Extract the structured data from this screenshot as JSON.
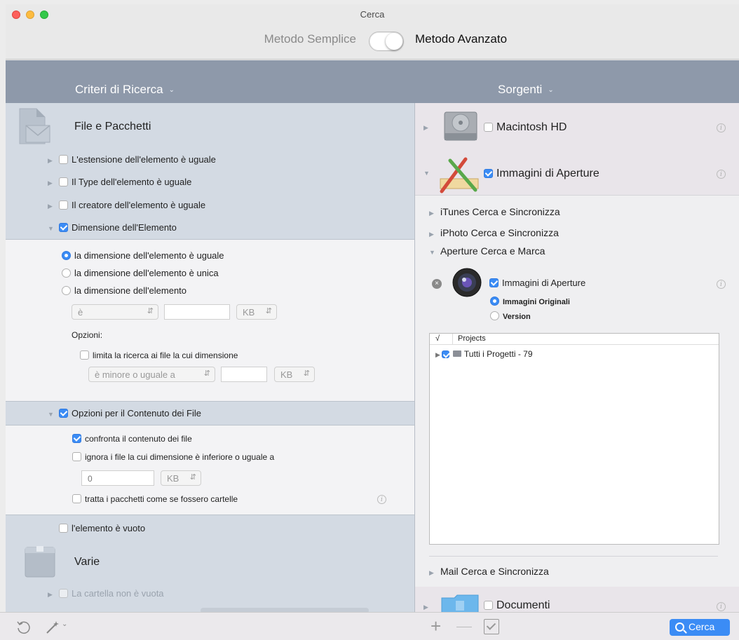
{
  "window": {
    "title": "Cerca"
  },
  "mode": {
    "simple": "Metodo Semplice",
    "advanced": "Metodo Avanzato"
  },
  "left": {
    "header": "Criteri di Ricerca",
    "group1": {
      "title": "File e Pacchetti",
      "items": [
        "L'estensione dell'elemento è uguale",
        "Il Type dell'elemento è uguale",
        "Il creatore dell'elemento è uguale",
        "Dimensione dell'Elemento"
      ],
      "size_panel": {
        "radio1": "la dimensione dell'elemento è uguale",
        "radio2": "la dimensione dell'elemento è unica",
        "radio3": "la dimensione dell'elemento",
        "op_select": "è",
        "unit1": "KB",
        "options_label": "Opzioni:",
        "limit_label": "limita la ricerca ai file la cui dimensione",
        "limit_select": "è minore o uguale a",
        "unit2": "KB"
      },
      "content_item": "Opzioni per il Contenuto dei File",
      "content_panel": {
        "compare": "confronta il contenuto dei file",
        "ignore": "ignora i file la cui dimensione è inferiore o uguale a",
        "size_value": "0",
        "unit": "KB",
        "packages": "tratta i pacchetti come se fossero cartelle"
      },
      "empty_item": "l'elemento è vuoto"
    },
    "group2": {
      "title": "Varie",
      "items": [
        "La cartella non è vuota"
      ]
    }
  },
  "right": {
    "header": "Sorgenti",
    "source1": "Macintosh HD",
    "source2": "Immagini di Aperture",
    "sub1": "iTunes Cerca e Sincronizza",
    "sub2": "iPhoto Cerca e Sincronizza",
    "sub3": "Aperture Cerca e Marca",
    "aperture_item": "Immagini di Aperture",
    "aperture_radio1": "Immagini Originali",
    "aperture_radio2": "Version",
    "table_check_header": "√",
    "table_header": "Projects",
    "table_row": "Tutti i Progetti - 79",
    "mail": "Mail Cerca e Sincronizza",
    "source3": "Documenti"
  },
  "footer": {
    "search_button": "Cerca"
  },
  "colors": {
    "accent": "#3b8cf5",
    "header": "#8e99aa",
    "left_bg": "#d3dae3",
    "right_bg": "#efeff1"
  }
}
